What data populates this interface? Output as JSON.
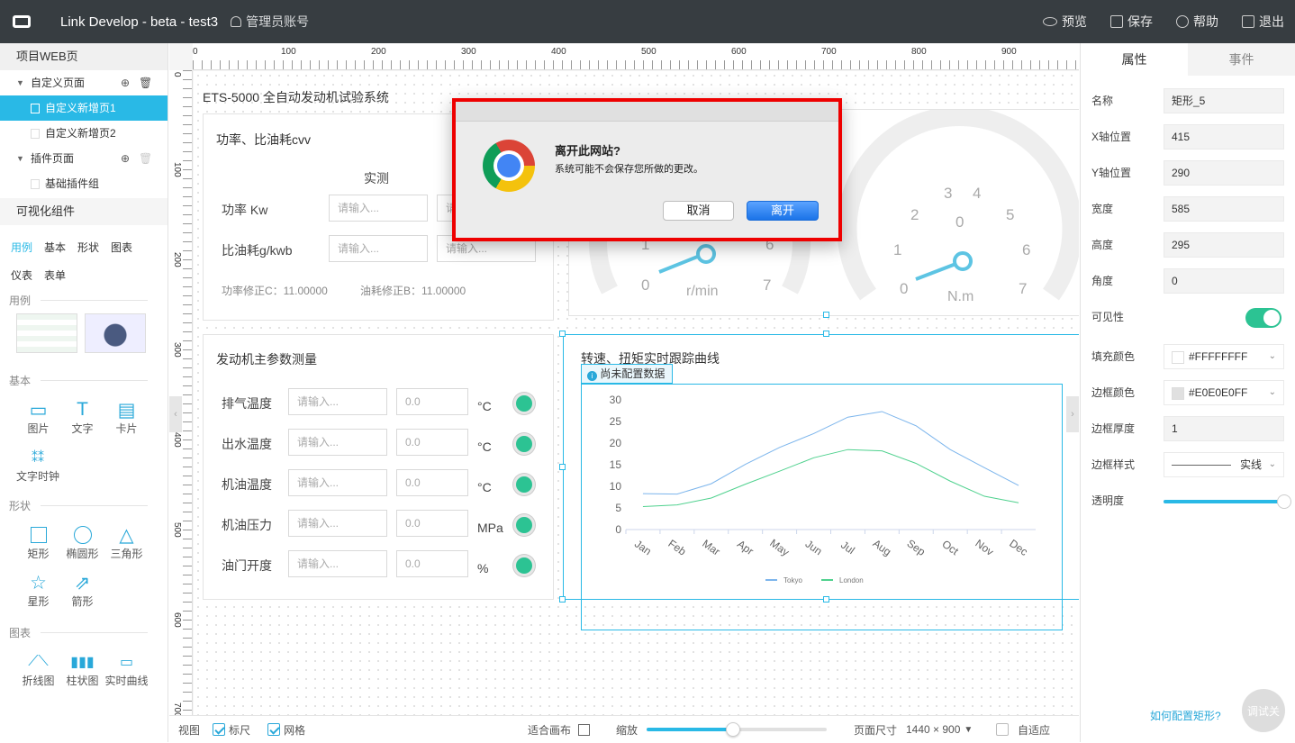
{
  "header": {
    "app_title": "Link Develop - beta - test3",
    "user": "管理员账号",
    "nav": [
      "预览",
      "保存",
      "帮助",
      "退出"
    ]
  },
  "sidebar": {
    "project_section": "项目WEB页",
    "custom_pages": "自定义页面",
    "page1": "自定义新增页1",
    "page2": "自定义新增页2",
    "plugin_pages": "插件页面",
    "basic_plugin": "基础插件组",
    "visual_section": "可视化组件",
    "tabs": [
      "用例",
      "基本",
      "形状",
      "图表",
      "仪表",
      "表单"
    ],
    "group_examples": "用例",
    "group_basic": "基本",
    "basic_items": [
      "图片",
      "文字",
      "卡片",
      "文字时钟"
    ],
    "group_shape": "形状",
    "shape_items": [
      "矩形",
      "椭圆形",
      "三角形",
      "星形",
      "箭形"
    ],
    "group_chart": "图表",
    "chart_items": [
      "折线图",
      "柱状图",
      "实时曲线"
    ]
  },
  "ruler": {
    "h": [
      "0",
      "100",
      "200",
      "300",
      "400",
      "500",
      "600",
      "700",
      "800",
      "900"
    ],
    "v": [
      "0",
      "100",
      "200",
      "300",
      "400",
      "500",
      "600",
      "700"
    ]
  },
  "canvas": {
    "page_title": "ETS-5000 全自动发动机试验系统",
    "power_panel_title": "功率、比油耗cvv",
    "measured": "实测",
    "power_label": "功率 Kw",
    "fuel_label": "比油耗g/kwb",
    "placeholder": "请输入...",
    "power_corr": "功率修正C：11.00000",
    "fuel_corr": "油耗修正B：11.00000",
    "engine_panel_title": "发动机主参数测量",
    "engine_rows": [
      {
        "label": "排气温度",
        "value": "0.0",
        "unit": "°C"
      },
      {
        "label": "出水温度",
        "value": "0.0",
        "unit": "°C"
      },
      {
        "label": "机油温度",
        "value": "0.0",
        "unit": "°C"
      },
      {
        "label": "机油压力",
        "value": "0.0",
        "unit": "MPa"
      },
      {
        "label": "油门开度",
        "value": "0.0",
        "unit": "%"
      }
    ],
    "gauge1_unit": "r/min",
    "gauge1_ticks": [
      "1",
      "6",
      "0",
      "7"
    ],
    "gauge2_unit": "N.m",
    "gauge2_ticks": [
      "0",
      "1",
      "2",
      "3",
      "4",
      "5",
      "6",
      "7",
      "0"
    ],
    "curve_panel_title": "转速、扭矩实时跟踪曲线",
    "no_data_badge": "尚未配置数据"
  },
  "chart_data": {
    "type": "line",
    "categories": [
      "Jan",
      "Feb",
      "Mar",
      "Apr",
      "May",
      "Jun",
      "Jul",
      "Aug",
      "Sep",
      "Oct",
      "Nov",
      "Dec"
    ],
    "yticks": [
      "0",
      "5",
      "10",
      "15",
      "20",
      "25",
      "30"
    ],
    "ylim": [
      0,
      30
    ],
    "series": [
      {
        "name": "Tokyo",
        "color": "#7cb5ec",
        "values": [
          8.3,
          8.2,
          10.6,
          15.1,
          19,
          22.2,
          26,
          27.3,
          24,
          18.5,
          14.3,
          10.2
        ]
      },
      {
        "name": "London",
        "color": "#4fd18e",
        "values": [
          5.3,
          5.7,
          7.3,
          10.5,
          13.5,
          16.6,
          18.5,
          18.2,
          15.3,
          11.2,
          7.7,
          6.2
        ]
      }
    ],
    "legend": "bottom"
  },
  "bottombar": {
    "view": "视图",
    "ruler": "标尺",
    "grid": "网格",
    "fit": "适合画布",
    "zoom": "缩放",
    "zoom_level": 0.48,
    "page_size_label": "页面尺寸",
    "page_size": "1440 × 900",
    "auto": "自适应"
  },
  "props": {
    "tab_props": "属性",
    "tab_events": "事件",
    "name_label": "名称",
    "name": "矩形_5",
    "x_label": "X轴位置",
    "x": "415",
    "y_label": "Y轴位置",
    "y": "290",
    "w_label": "宽度",
    "w": "585",
    "h_label": "高度",
    "h": "295",
    "angle_label": "角度",
    "angle": "0",
    "visible_label": "可见性",
    "fill_label": "填充颜色",
    "fill": "#FFFFFFFF",
    "border_color_label": "边框颜色",
    "border_color": "#E0E0E0FF",
    "border_width_label": "边框厚度",
    "border_width": "1",
    "border_style_label": "边框样式",
    "border_style": "实线",
    "opacity_label": "透明度",
    "opacity": 1.0,
    "help_link": "如何配置矩形?",
    "debug": "调试关"
  },
  "dialog": {
    "title": "离开此网站?",
    "message": "系统可能不会保存您所做的更改。",
    "cancel": "取消",
    "leave": "离开",
    "highlight_color": "#ee0000"
  }
}
